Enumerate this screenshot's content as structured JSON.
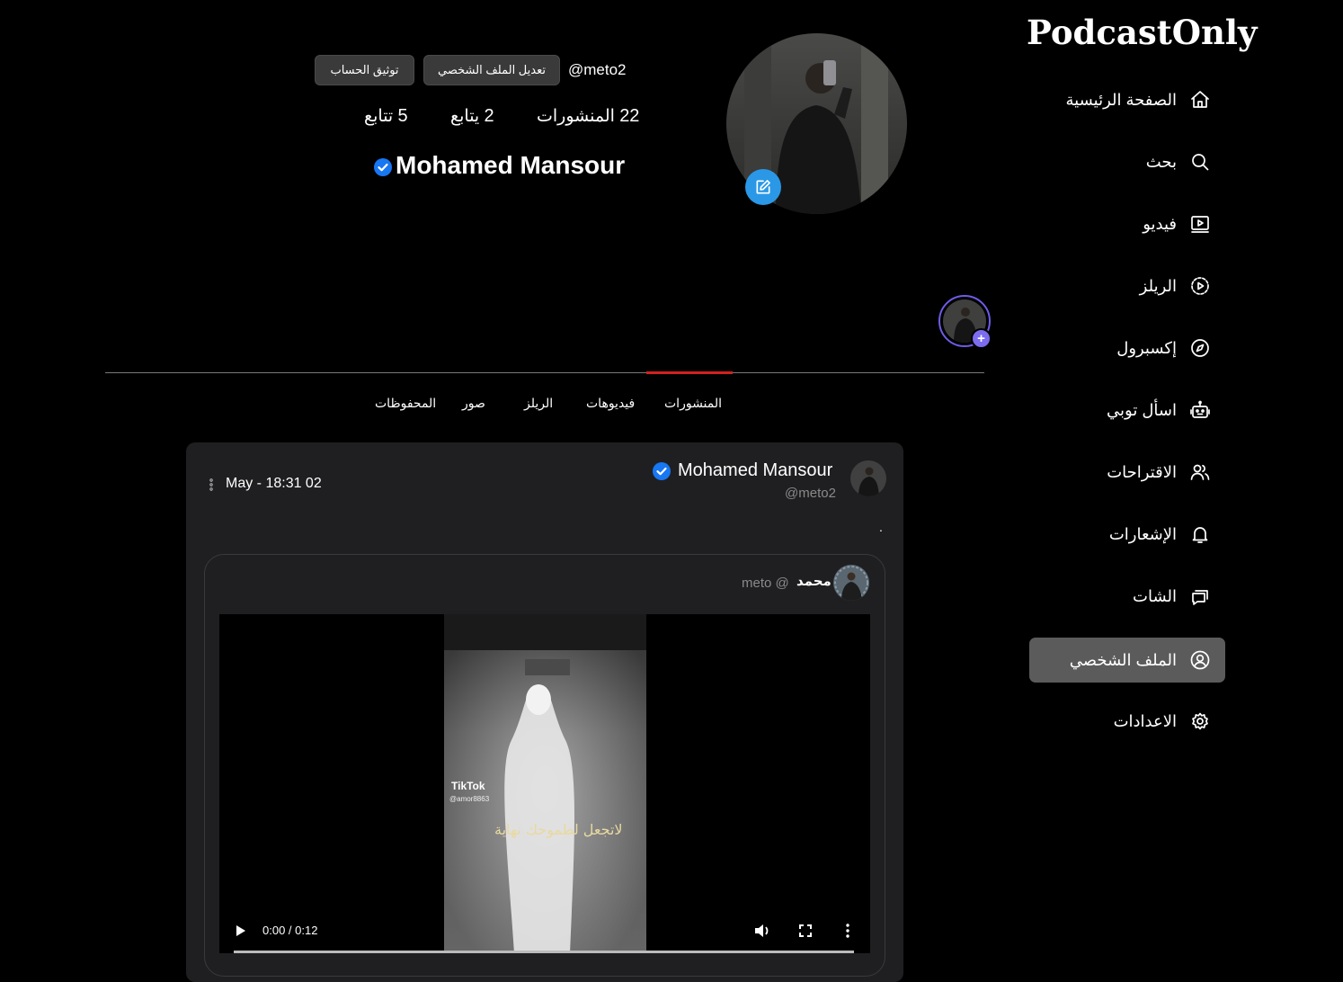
{
  "brand": "PodcastOnly",
  "sidebar": {
    "items": [
      {
        "label": "الصفحة الرئيسية",
        "icon": "home-icon"
      },
      {
        "label": "بحث",
        "icon": "search-icon"
      },
      {
        "label": "فيديو",
        "icon": "video-icon"
      },
      {
        "label": "الريلز",
        "icon": "reels-icon"
      },
      {
        "label": "إكسبرول",
        "icon": "compass-icon"
      },
      {
        "label": "اسأل توبي",
        "icon": "robot-icon"
      },
      {
        "label": "الاقتراحات",
        "icon": "users-icon"
      },
      {
        "label": "الإشعارات",
        "icon": "bell-icon"
      },
      {
        "label": "الشات",
        "icon": "chat-icon"
      },
      {
        "label": "الملف الشخصي",
        "icon": "profile-icon",
        "active": true
      },
      {
        "label": "الاعدادات",
        "icon": "settings-icon"
      }
    ]
  },
  "profile": {
    "username": "@meto2",
    "edit_profile_label": "تعديل الملف الشخصي",
    "verify_account_label": "توثيق الحساب",
    "stats": {
      "posts": {
        "count": "22",
        "label": "المنشورات"
      },
      "following": {
        "count": "2",
        "label": "يتابع"
      },
      "followers": {
        "count": "5",
        "label": "تتابع"
      }
    },
    "display_name": "Mohamed Mansour"
  },
  "tabs": [
    "المنشورات",
    "فيديوهات",
    "الريلز",
    "صور",
    "المحفوظات"
  ],
  "post": {
    "author_name": "Mohamed Mansour",
    "author_handle": "@meto2",
    "date": "May - 18:31 02",
    "text": ".",
    "repost": {
      "name": "محمد",
      "handle": "meto @",
      "video": {
        "time": "0:00 / 0:12",
        "watermark": "TikTok",
        "watermark_handle": "@amor8863",
        "caption": "لاتجعل لطموحك نهاية"
      }
    }
  },
  "colors": {
    "background": "#000000",
    "active_nav": "#5b5b5b",
    "accent_red": "#d32020",
    "edit_blue": "#2a98e6",
    "verified_blue": "#1877f2",
    "story_purple": "#7b6cf0"
  }
}
